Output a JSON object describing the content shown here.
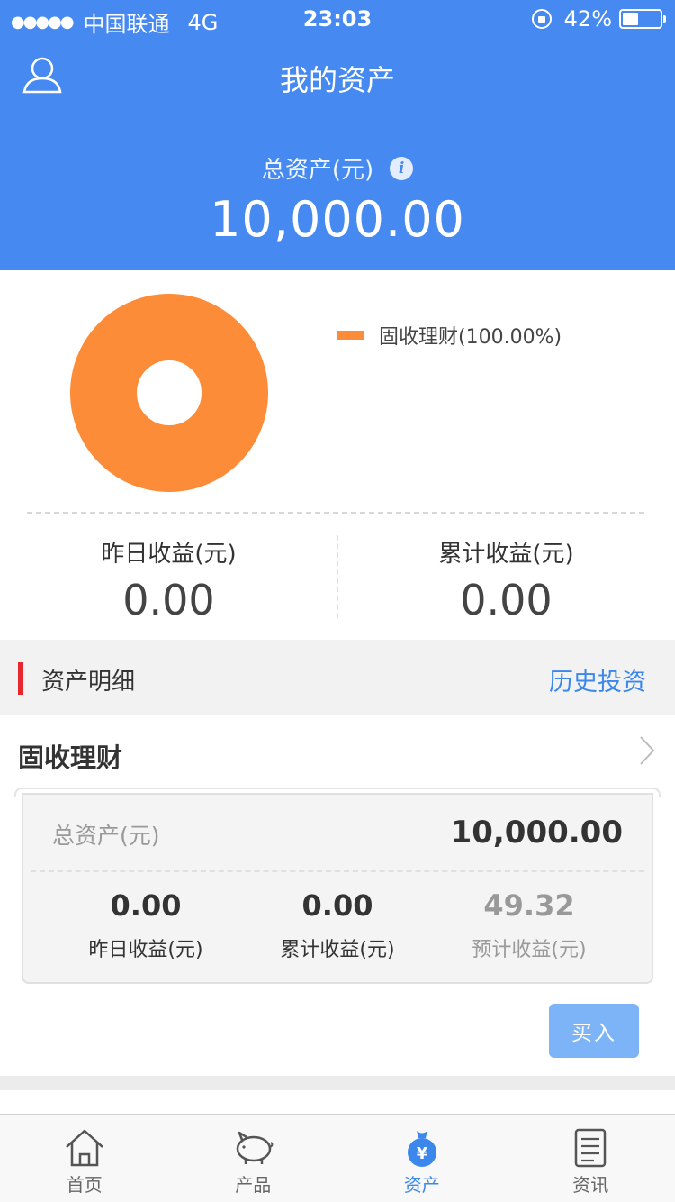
{
  "status_bar": {
    "signal": "●●●●●",
    "carrier": "中国联通",
    "network": "4G",
    "time": "23:03",
    "battery": "42%",
    "battery_level": 0.42
  },
  "header": {
    "title": "我的资产",
    "total_label": "总资产(元)",
    "info_icon": "i",
    "total_value": "10,000.00"
  },
  "chart_data": {
    "type": "pie",
    "categories": [
      "固收理财"
    ],
    "values": [
      100.0
    ],
    "legend": [
      "固收理财(100.00%)"
    ],
    "colors": [
      "#fd8c38"
    ]
  },
  "earnings": {
    "yesterday_label": "昨日收益(元)",
    "yesterday_value": "0.00",
    "cumulative_label": "累计收益(元)",
    "cumulative_value": "0.00"
  },
  "detail": {
    "label": "资产明细",
    "history_link": "历史投资"
  },
  "product": {
    "name": "固收理财",
    "total_label": "总资产(元)",
    "total_value": "10,000.00",
    "stats": [
      {
        "value": "0.00",
        "label": "昨日收益(元)"
      },
      {
        "value": "0.00",
        "label": "累计收益(元)"
      },
      {
        "value": "49.32",
        "label": "预计收益(元)"
      }
    ],
    "buy_label": "买入"
  },
  "tabs": [
    {
      "label": "首页",
      "icon": "home-icon"
    },
    {
      "label": "产品",
      "icon": "piggy-bank-icon"
    },
    {
      "label": "资产",
      "icon": "money-bag-icon"
    },
    {
      "label": "资讯",
      "icon": "news-icon"
    }
  ],
  "colors": {
    "primary": "#4689f1",
    "accent": "#fd8c38",
    "red": "#e8262d",
    "link": "#3c87ec"
  }
}
